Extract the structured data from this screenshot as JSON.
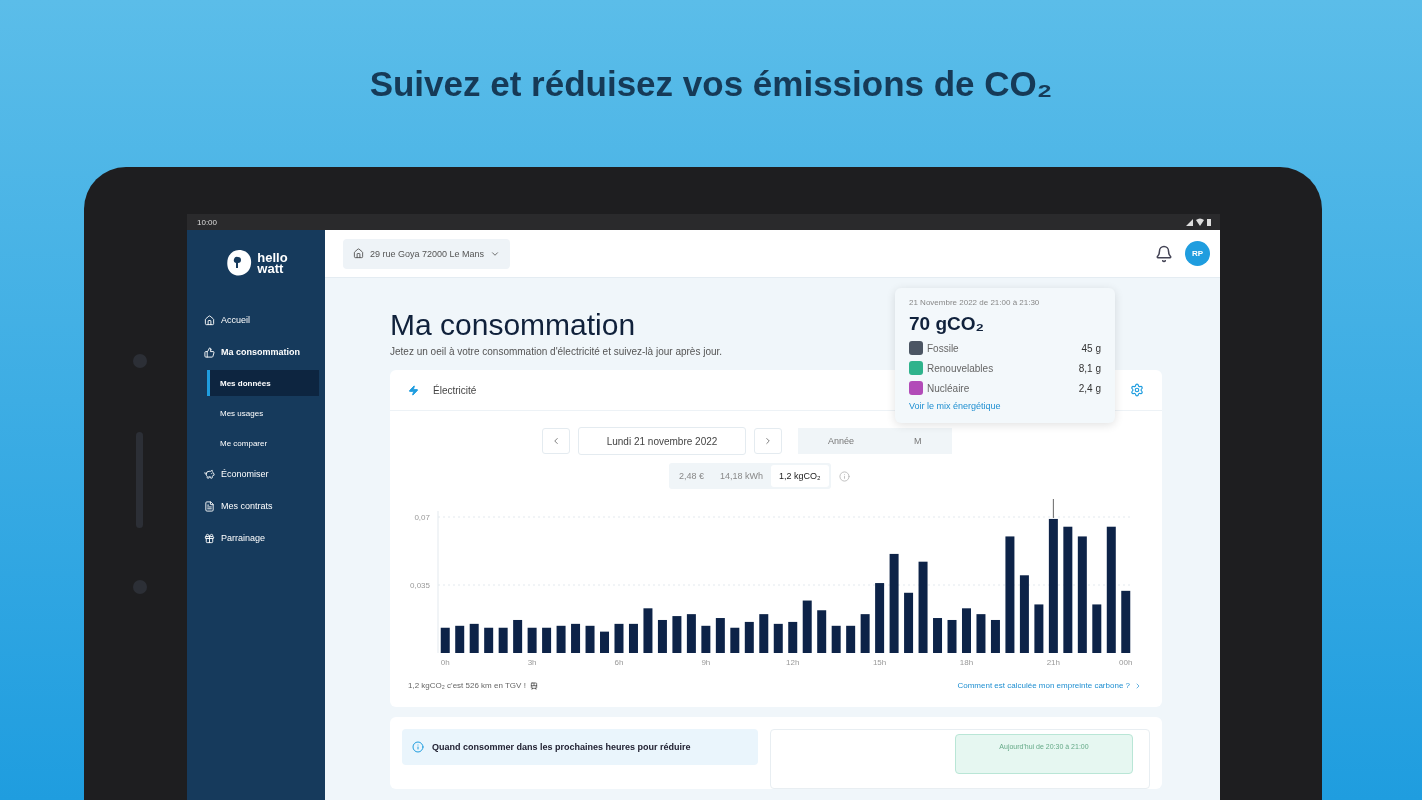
{
  "headline": "Suivez et réduisez vos émissions de CO₂",
  "status_bar": {
    "time": "10:00"
  },
  "sidebar": {
    "logo": {
      "line_1": "hello",
      "line_2": "watt"
    },
    "items": [
      {
        "label": "Accueil",
        "selected": false
      },
      {
        "label": "Ma consommation",
        "selected": false,
        "expanded": true,
        "children": [
          {
            "label": "Mes données",
            "selected": true
          },
          {
            "label": "Mes usages",
            "selected": false
          },
          {
            "label": "Me comparer",
            "selected": false
          }
        ]
      },
      {
        "label": "Économiser",
        "selected": false
      },
      {
        "label": "Mes contrats",
        "selected": false
      },
      {
        "label": "Parrainage",
        "selected": false
      }
    ]
  },
  "topbar": {
    "address": "29 rue Goya 72000 Le Mans",
    "avatar": "RP"
  },
  "page": {
    "title": "Ma consommation",
    "subtitle": "Jetez un oeil à votre consommation d'électricité et suivez-là jour après jour."
  },
  "card": {
    "title": "Électricité",
    "date": "Lundi 21 novembre 2022",
    "periods": [
      {
        "label": "Année"
      },
      {
        "label": "M"
      }
    ],
    "units": [
      {
        "label": "2,48 €",
        "selected": false
      },
      {
        "label": "14,18 kWh",
        "selected": false
      },
      {
        "label": "1,2 kgCO₂",
        "selected": true
      }
    ],
    "chart_data": {
      "type": "bar",
      "categories": [
        "0h",
        null,
        null,
        null,
        null,
        null,
        "3h",
        null,
        null,
        null,
        null,
        null,
        "6h",
        null,
        null,
        null,
        null,
        null,
        "9h",
        null,
        null,
        null,
        null,
        null,
        "12h",
        null,
        null,
        null,
        null,
        null,
        "15h",
        null,
        null,
        null,
        null,
        null,
        "18h",
        null,
        null,
        null,
        null,
        null,
        "21h",
        null,
        null,
        null,
        null,
        "00h"
      ],
      "series": [
        {
          "color": "#0d2348",
          "values": [
            0.013,
            0.014,
            0.015,
            0.013,
            0.013,
            0.017,
            0.013,
            0.013,
            0.014,
            0.015,
            0.014,
            0.011,
            0.015,
            0.015,
            0.023,
            0.017,
            0.019,
            0.02,
            0.014,
            0.018,
            0.013,
            0.016,
            0.02,
            0.015,
            0.016,
            0.027,
            0.022,
            0.014,
            0.014,
            0.02,
            0.036,
            0.051,
            0.031,
            0.047,
            0.018,
            0.017,
            0.023,
            0.02,
            0.017,
            0.06,
            0.04,
            0.025,
            0.069,
            0.065,
            0.06,
            0.025,
            0.065,
            0.032
          ]
        }
      ],
      "ylim": [
        0,
        0.07
      ],
      "yticks": [
        {
          "value": 0.035,
          "label": "0,035"
        },
        {
          "value": 0.07,
          "label": "0,07"
        }
      ]
    },
    "footnote": "1,2 kgCO₂ c'est 526 km en TGV !",
    "link": "Comment est calculée mon empreinte carbone ?"
  },
  "tooltip": {
    "date": "21 Novembre 2022 de 21:00 à 21:30",
    "total": "70 gCO₂",
    "rows": [
      {
        "label": "Fossile",
        "value": "45 g",
        "color": "#4b5563"
      },
      {
        "label": "Renouvelables",
        "value": "8,1 g",
        "color": "#2fb38c"
      },
      {
        "label": "Nucléaire",
        "value": "2,4 g",
        "color": "#b24bb8"
      }
    ],
    "link": "Voir le mix énergétique"
  },
  "advice": {
    "text": "Quand consommer dans les prochaines heures pour réduire",
    "slot": "Aujourd'hui de 20:30 à 21:00"
  }
}
